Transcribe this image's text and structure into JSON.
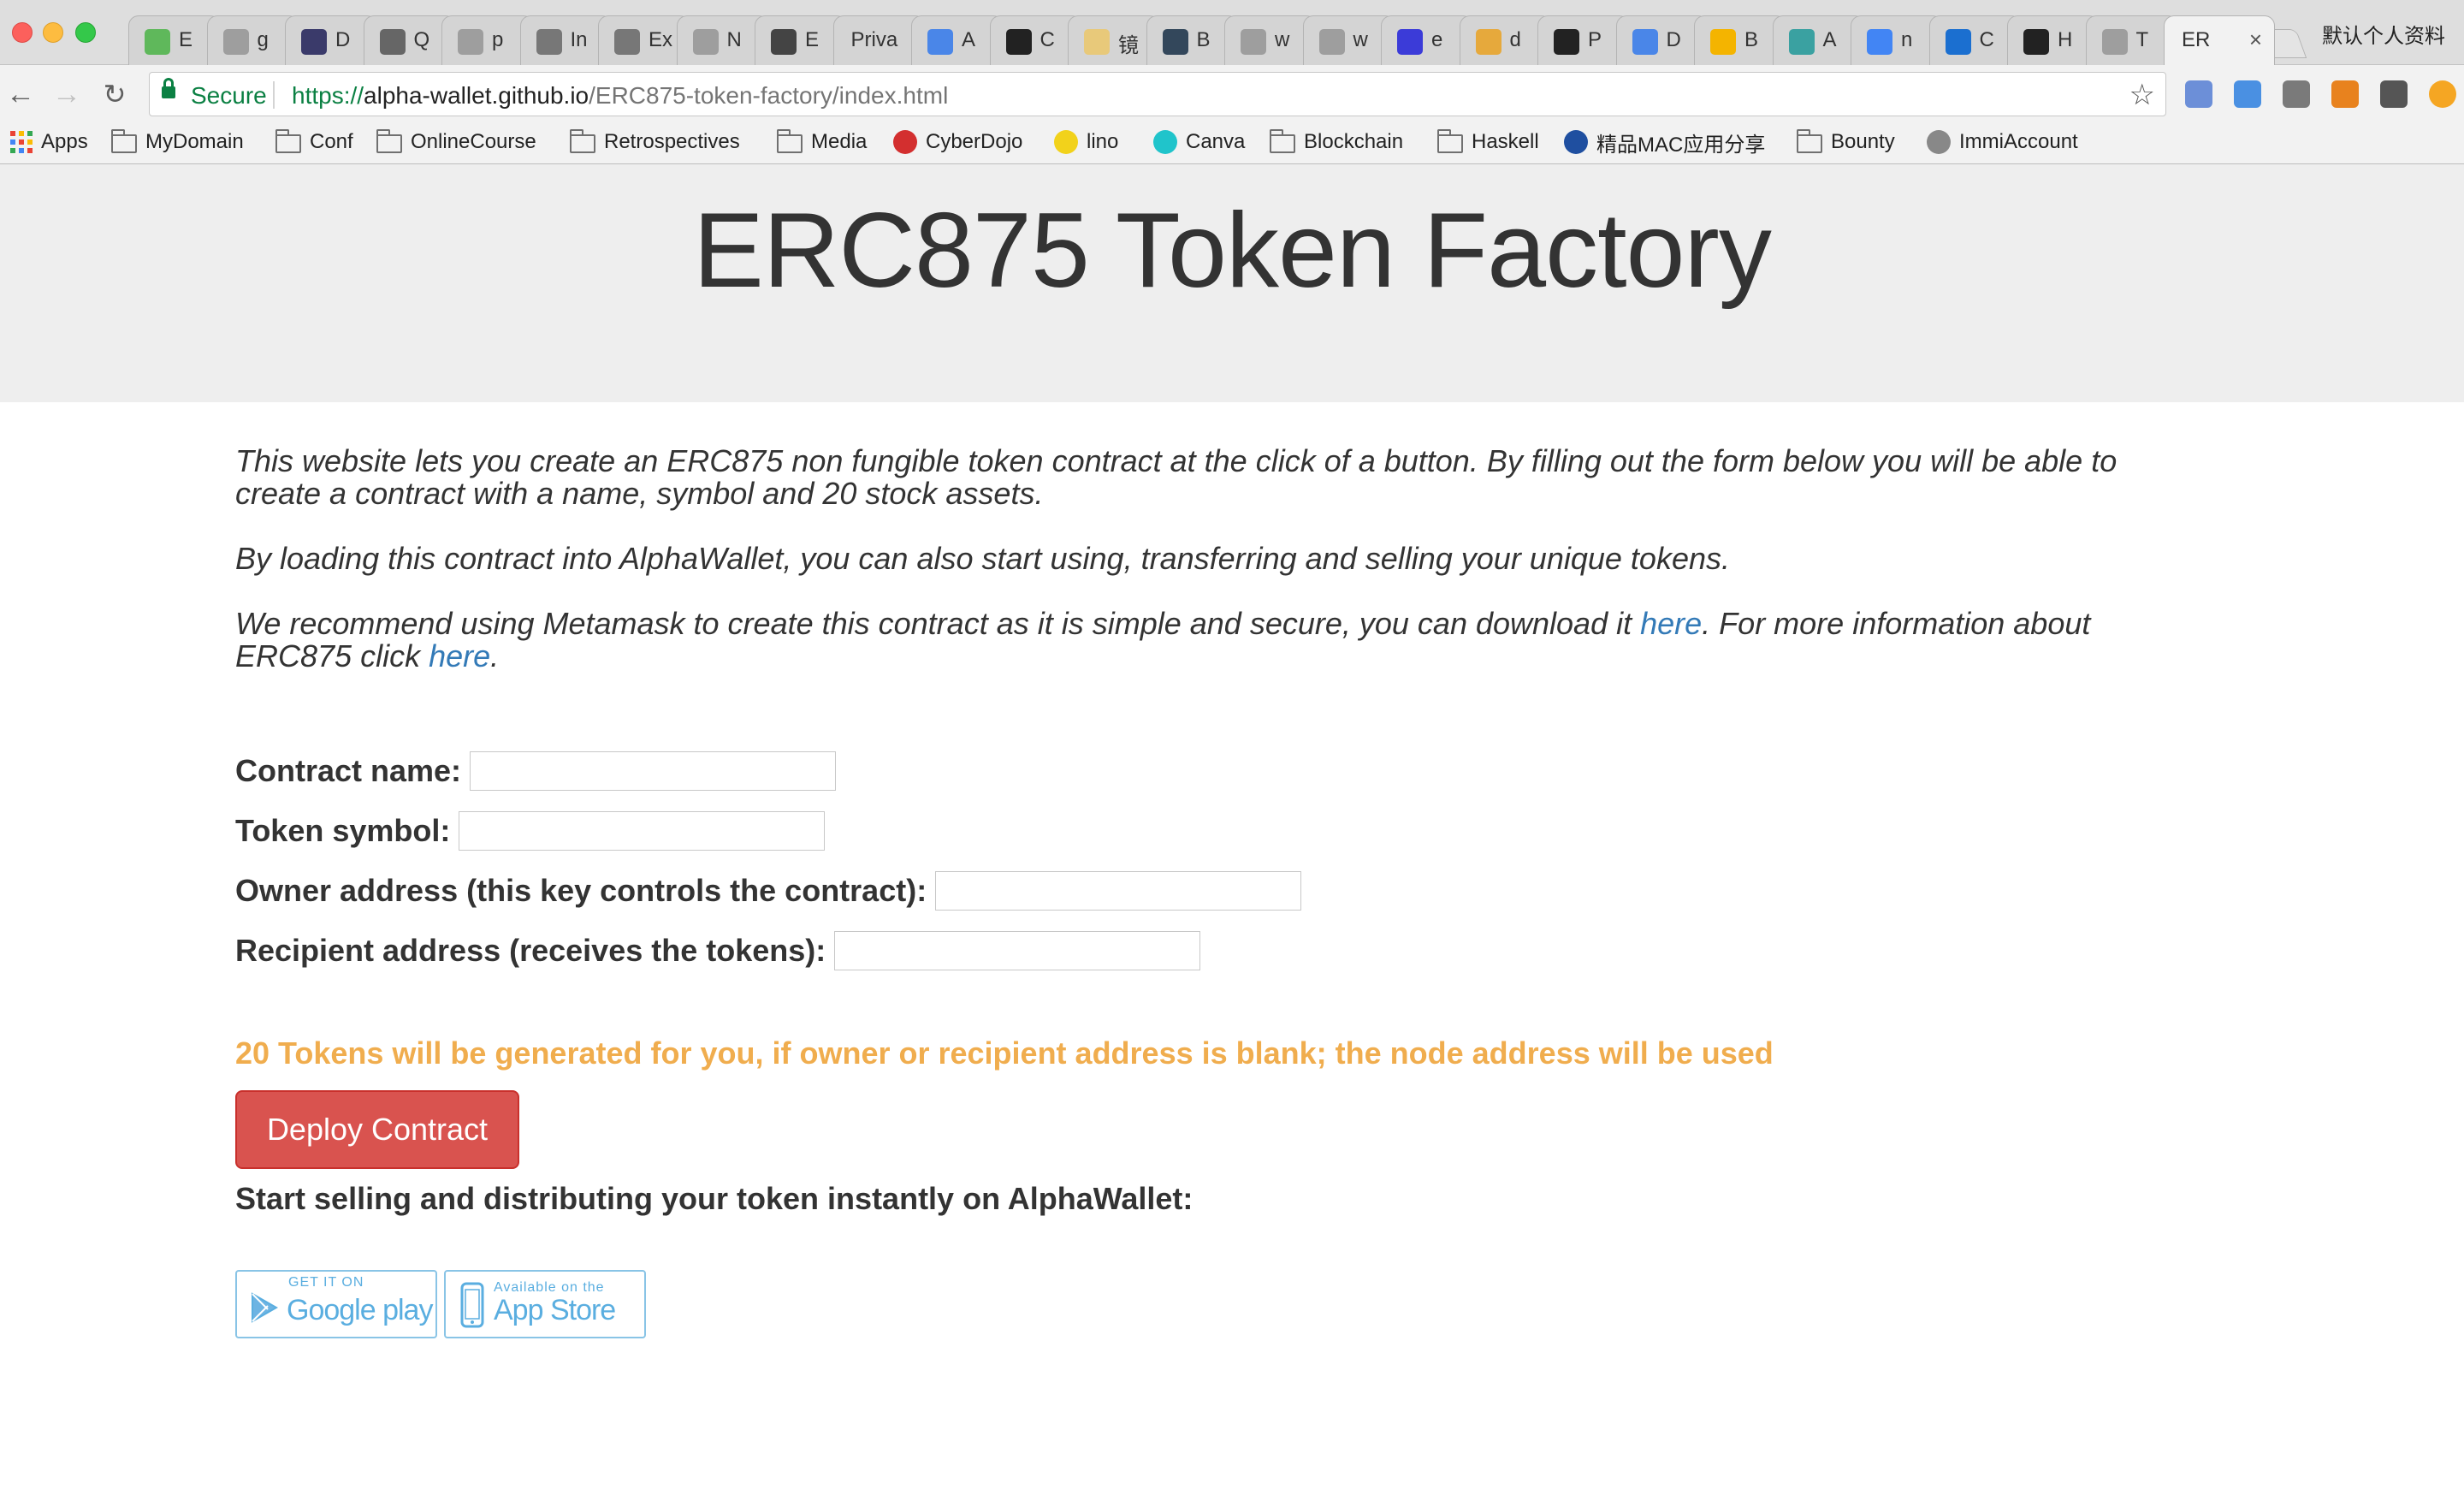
{
  "browser": {
    "tabs": [
      {
        "label": "E",
        "icon": "sheet-icon",
        "color": "#5fb85b"
      },
      {
        "label": "g",
        "icon": "page-icon",
        "color": "#9e9e9e"
      },
      {
        "label": "D",
        "icon": "e-icon",
        "color": "#3a3a6a"
      },
      {
        "label": "Q",
        "icon": "truffle-icon",
        "color": "#666666"
      },
      {
        "label": "p",
        "icon": "page-icon",
        "color": "#9e9e9e"
      },
      {
        "label": "In",
        "icon": "crest-icon",
        "color": "#777777"
      },
      {
        "label": "Ex",
        "icon": "speaker-icon",
        "color": "#777777"
      },
      {
        "label": "N",
        "icon": "page-icon",
        "color": "#9e9e9e"
      },
      {
        "label": "E",
        "icon": "cube-icon",
        "color": "#444444"
      },
      {
        "label": "Priva",
        "icon": "",
        "color": ""
      },
      {
        "label": "A",
        "icon": "docs-icon",
        "color": "#4a86e8"
      },
      {
        "label": "C",
        "icon": "github-icon",
        "color": "#222222"
      },
      {
        "label": "镜",
        "icon": "cp-icon",
        "color": "#e8c97a"
      },
      {
        "label": "B",
        "icon": "b-icon",
        "color": "#33475b"
      },
      {
        "label": "w",
        "icon": "page-icon",
        "color": "#9e9e9e"
      },
      {
        "label": "w",
        "icon": "page-icon",
        "color": "#9e9e9e"
      },
      {
        "label": "e",
        "icon": "wave-icon",
        "color": "#3b3bd8"
      },
      {
        "label": "d",
        "icon": "ethereum-icon",
        "color": "#e6a93c"
      },
      {
        "label": "P",
        "icon": "plr-icon",
        "color": "#222222"
      },
      {
        "label": "D",
        "icon": "docs-icon",
        "color": "#4a86e8"
      },
      {
        "label": "B",
        "icon": "drive-icon",
        "color": "#f4b400"
      },
      {
        "label": "A",
        "icon": "hexagon-icon",
        "color": "#3aa1a1"
      },
      {
        "label": "n",
        "icon": "google-icon",
        "color": "#4285f4"
      },
      {
        "label": "C",
        "icon": "kotlin-icon",
        "color": "#1b6fd0"
      },
      {
        "label": "H",
        "icon": "github-icon",
        "color": "#222222"
      },
      {
        "label": "T",
        "icon": "page-icon",
        "color": "#9e9e9e"
      }
    ],
    "active_tab": {
      "label": "ER",
      "close": "×"
    },
    "profile": "默认个人资料",
    "secure_label": "Secure",
    "url": {
      "scheme": "https://",
      "host": "alpha-wallet.github.io",
      "path": "/ERC875-token-factory/index.html"
    },
    "star": "☆",
    "extensions": [
      {
        "icon": "translate-icon",
        "color": "#6c8fd8"
      },
      {
        "icon": "blue-extension-icon",
        "color": "#4a90e2"
      },
      {
        "icon": "evernote-icon",
        "color": "#7a7a7a"
      },
      {
        "icon": "metamask-icon",
        "color": "#e8821e"
      },
      {
        "icon": "c-extension-icon",
        "color": "#555555"
      },
      {
        "icon": "orange-extension-icon",
        "color": "#f5a623"
      }
    ],
    "bookmarks": [
      {
        "label": "Apps",
        "type": "apps"
      },
      {
        "label": "MyDomain",
        "type": "folder"
      },
      {
        "label": "Conf",
        "type": "folder"
      },
      {
        "label": "OnlineCourse",
        "type": "folder"
      },
      {
        "label": "Retrospectives",
        "type": "folder"
      },
      {
        "label": "Media",
        "type": "folder"
      },
      {
        "label": "CyberDojo",
        "type": "site",
        "color": "#d32f2f"
      },
      {
        "label": "lino",
        "type": "site",
        "color": "#f2d21b"
      },
      {
        "label": "Canva",
        "type": "site",
        "color": "#20c4cb"
      },
      {
        "label": "Blockchain",
        "type": "folder"
      },
      {
        "label": "Haskell",
        "type": "folder"
      },
      {
        "label": "精品MAC应用分享",
        "type": "site",
        "color": "#1f4fa0"
      },
      {
        "label": "Bounty",
        "type": "folder"
      },
      {
        "label": "ImmiAccount",
        "type": "site",
        "color": "#888888"
      }
    ]
  },
  "page": {
    "title": "ERC875 Token Factory",
    "intro1": "This website lets you create an ERC875 non fungible token contract at the click of a button. By filling out the form below you will be able to create a contract with a name, symbol and 20 stock assets.",
    "intro2": "By loading this contract into AlphaWallet, you can also start using, transferring and selling your unique tokens.",
    "intro3_a": "We recommend using Metamask to create this contract as it is simple and secure, you can download it ",
    "intro3_link1": "here",
    "intro3_b": ". For more information about ERC875 click ",
    "intro3_link2": "here",
    "intro3_c": ".",
    "form": {
      "contract_name_label": "Contract name:",
      "token_symbol_label": "Token symbol:",
      "owner_label": "Owner address (this key controls the contract):",
      "recipient_label": "Recipient address (receives the tokens):"
    },
    "notice": "20 Tokens will be generated for you, if owner or recipient address is blank; the node address will be used",
    "deploy_button": "Deploy Contract",
    "sell_heading": "Start selling and distributing your token instantly on AlphaWallet:",
    "google_play": {
      "small": "GET IT ON",
      "big": "Google play"
    },
    "app_store": {
      "small": "Available on the",
      "big": "App Store"
    },
    "colors": {
      "notice": "#f0ad4e",
      "deploy": "#d9534f",
      "link": "#337ab7",
      "header_bg": "#eeeeee"
    }
  }
}
